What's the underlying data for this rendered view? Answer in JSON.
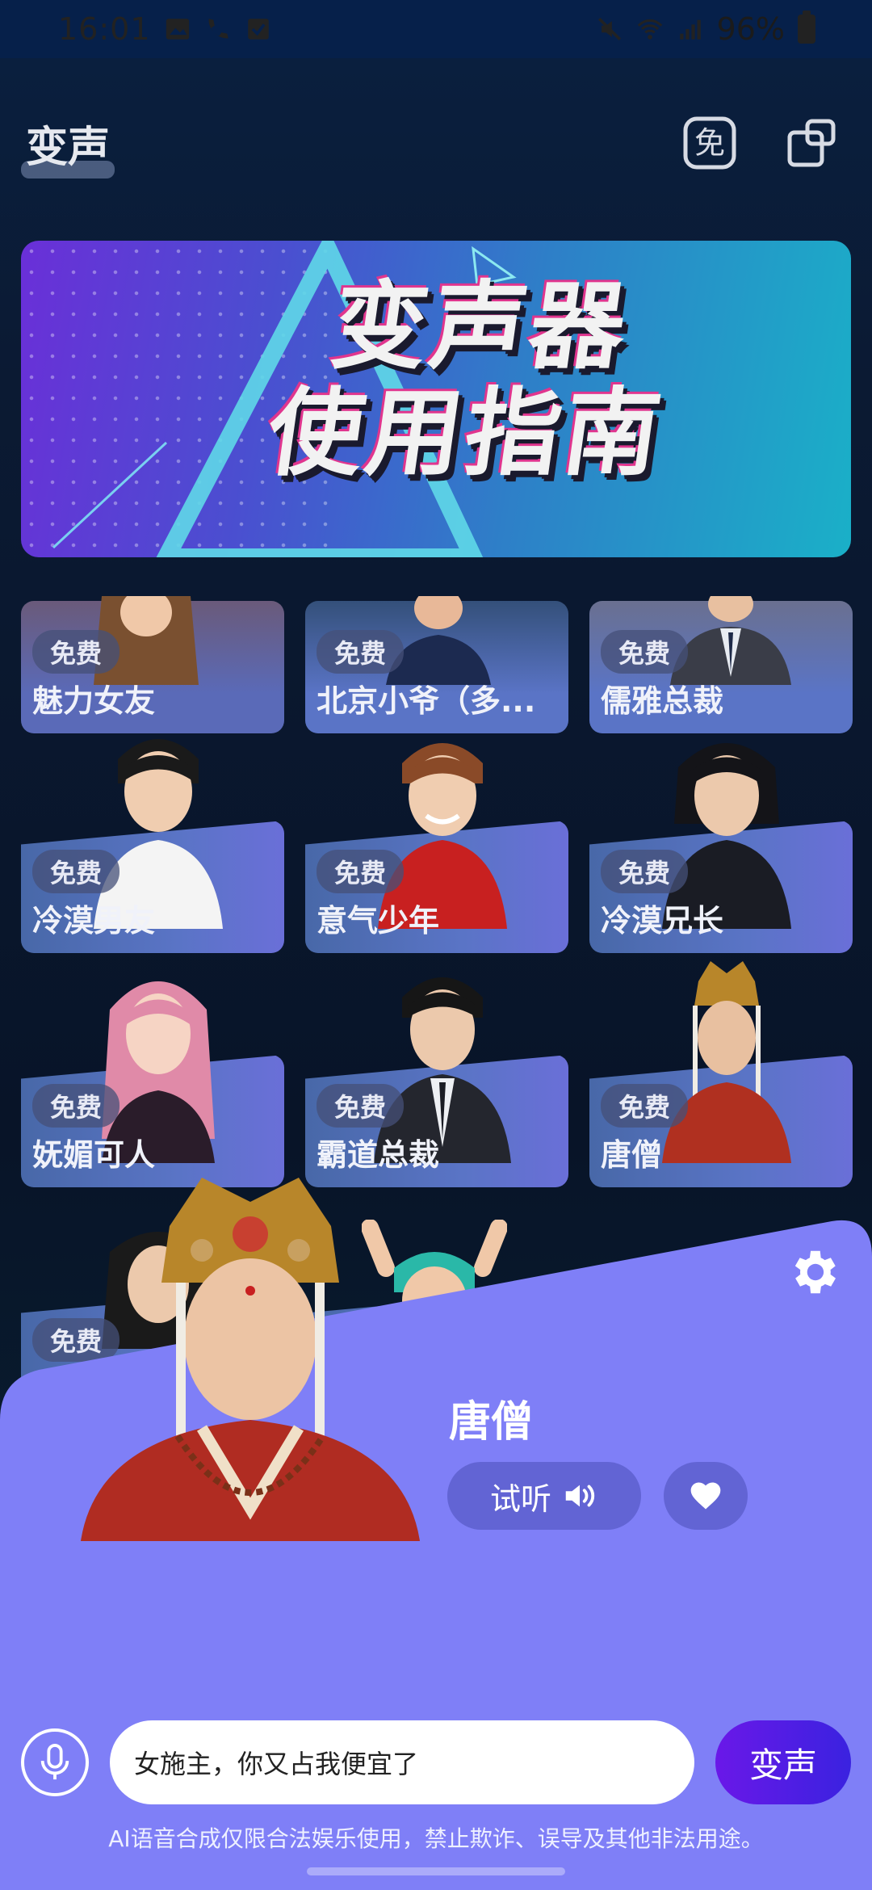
{
  "status_bar": {
    "time": "16:01",
    "battery": "96%",
    "icons": [
      "image-icon",
      "wifi-call-icon",
      "check-icon",
      "mute-icon",
      "wifi-icon",
      "signal-icon",
      "battery-icon"
    ]
  },
  "header": {
    "title": "变声",
    "free_icon_text": "免",
    "actions": [
      "free-icon",
      "open-window-icon"
    ]
  },
  "banner": {
    "line1": "变声器",
    "line2": "使用指南"
  },
  "voices": [
    {
      "badge": "免费",
      "name": "魅力女友"
    },
    {
      "badge": "免费",
      "name": "北京小爷（多..."
    },
    {
      "badge": "免费",
      "name": "儒雅总裁"
    },
    {
      "badge": "免费",
      "name": "冷漠男友"
    },
    {
      "badge": "免费",
      "name": "意气少年"
    },
    {
      "badge": "免费",
      "name": "冷漠兄长"
    },
    {
      "badge": "免费",
      "name": "妩媚可人"
    },
    {
      "badge": "免费",
      "name": "霸道总裁"
    },
    {
      "badge": "免费",
      "name": "唐僧"
    },
    {
      "badge": "免费",
      "name": ""
    }
  ],
  "sheet": {
    "selected_voice": "唐僧",
    "preview_label": "试听",
    "colors": {
      "sheet": "#7f7ff7",
      "pill": "#6264d4",
      "accent": "#5b1de6"
    }
  },
  "input": {
    "value": "女施主，你又占我便宜了",
    "convert_label": "变声"
  },
  "disclaimer": "AI语音合成仅限合法娱乐使用，禁止欺诈、误导及其他非法用途。"
}
